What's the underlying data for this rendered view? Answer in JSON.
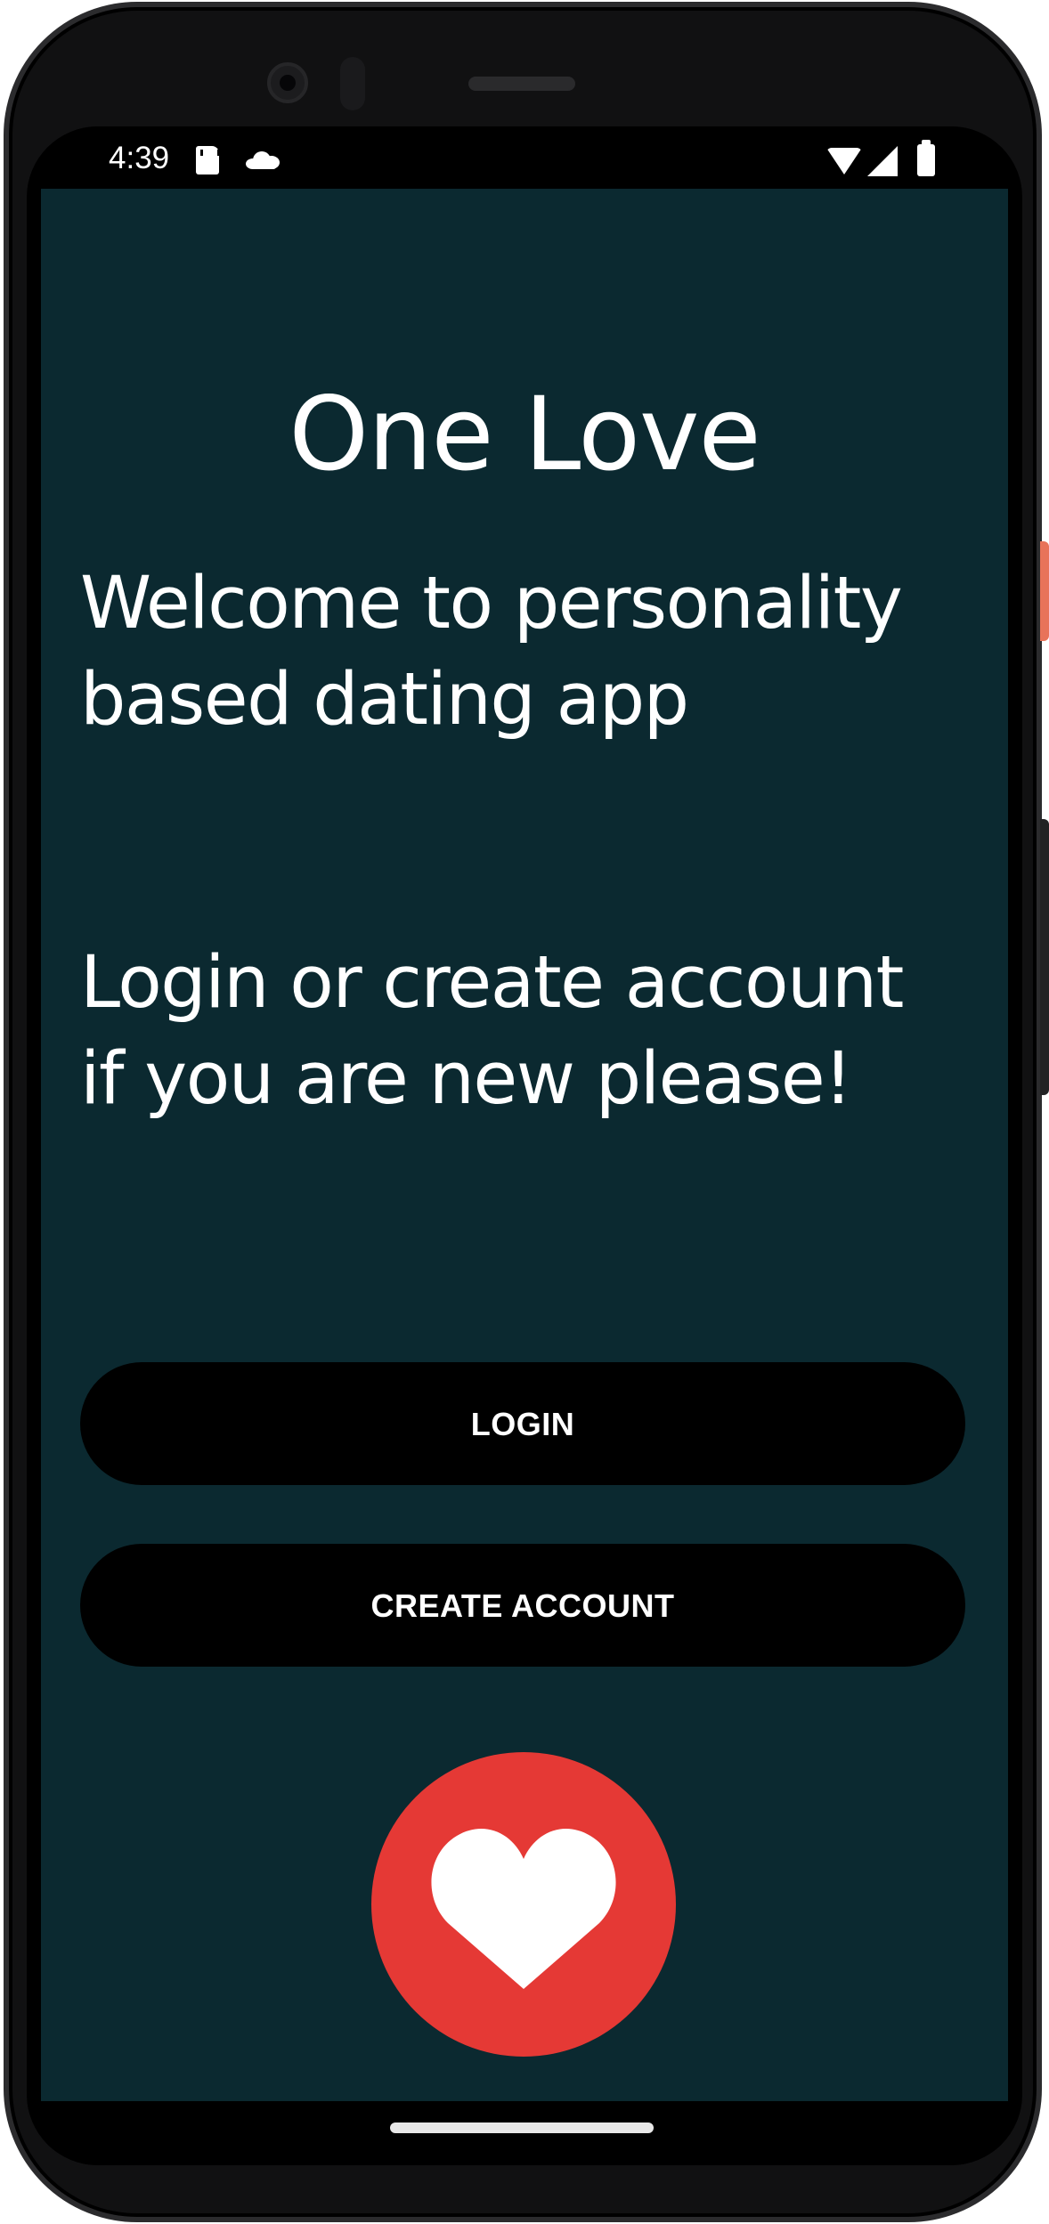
{
  "status_bar": {
    "time": "4:39",
    "icons": [
      "sd-card-icon",
      "cloud-icon",
      "wifi-icon",
      "cell-signal-icon",
      "battery-icon"
    ]
  },
  "app": {
    "title": "One Love",
    "welcome": "Welcome to personality based dating app",
    "welcome_lines": [
      "Welcome to personality",
      "based dating app"
    ],
    "prompt": "Login or create account if you are new please!",
    "prompt_lines": [
      "Login or create account",
      "if you are new please!"
    ],
    "buttons": {
      "login": "LOGIN",
      "create_account": "CREATE ACCOUNT"
    },
    "fab_icon": "heart-icon"
  },
  "colors": {
    "background": "#0b2930",
    "button": "#000000",
    "button_text": "#ffffff",
    "fab": "#e53935",
    "text": "#ffffff"
  }
}
